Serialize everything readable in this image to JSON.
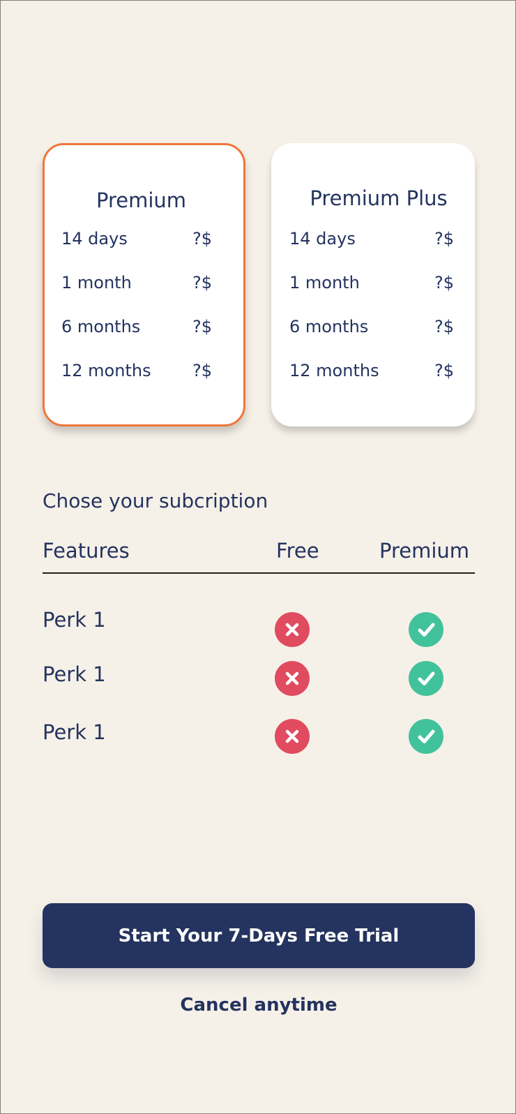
{
  "plans": [
    {
      "title": "Premium",
      "selected": true,
      "rows": [
        {
          "duration": "14 days",
          "price": "?$"
        },
        {
          "duration": "1 month",
          "price": "?$"
        },
        {
          "duration": "6 months",
          "price": "?$"
        },
        {
          "duration": "12 months",
          "price": "?$"
        }
      ]
    },
    {
      "title": "Premium Plus",
      "selected": false,
      "rows": [
        {
          "duration": "14 days",
          "price": "?$"
        },
        {
          "duration": "1 month",
          "price": "?$"
        },
        {
          "duration": "6 months",
          "price": "?$"
        },
        {
          "duration": "12 months",
          "price": "?$"
        }
      ]
    }
  ],
  "subscription": {
    "title": "Chose your subcription",
    "headers": {
      "features": "Features",
      "free": "Free",
      "premium": "Premium"
    },
    "perks": [
      {
        "label": "Perk 1",
        "free": "x-icon",
        "premium": "check-icon"
      },
      {
        "label": "Perk 1",
        "free": "x-icon",
        "premium": "check-icon"
      },
      {
        "label": "Perk 1",
        "free": "x-icon",
        "premium": "check-icon"
      }
    ]
  },
  "cta": {
    "label": "Start Your 7-Days Free Trial"
  },
  "cancel": {
    "label": "Cancel anytime"
  },
  "colors": {
    "background": "#f6f1e8",
    "text": "#24335f",
    "selected_border": "#f0763b",
    "no_icon": "#e04b5f",
    "yes_icon": "#42c29b",
    "button": "#24335f"
  }
}
